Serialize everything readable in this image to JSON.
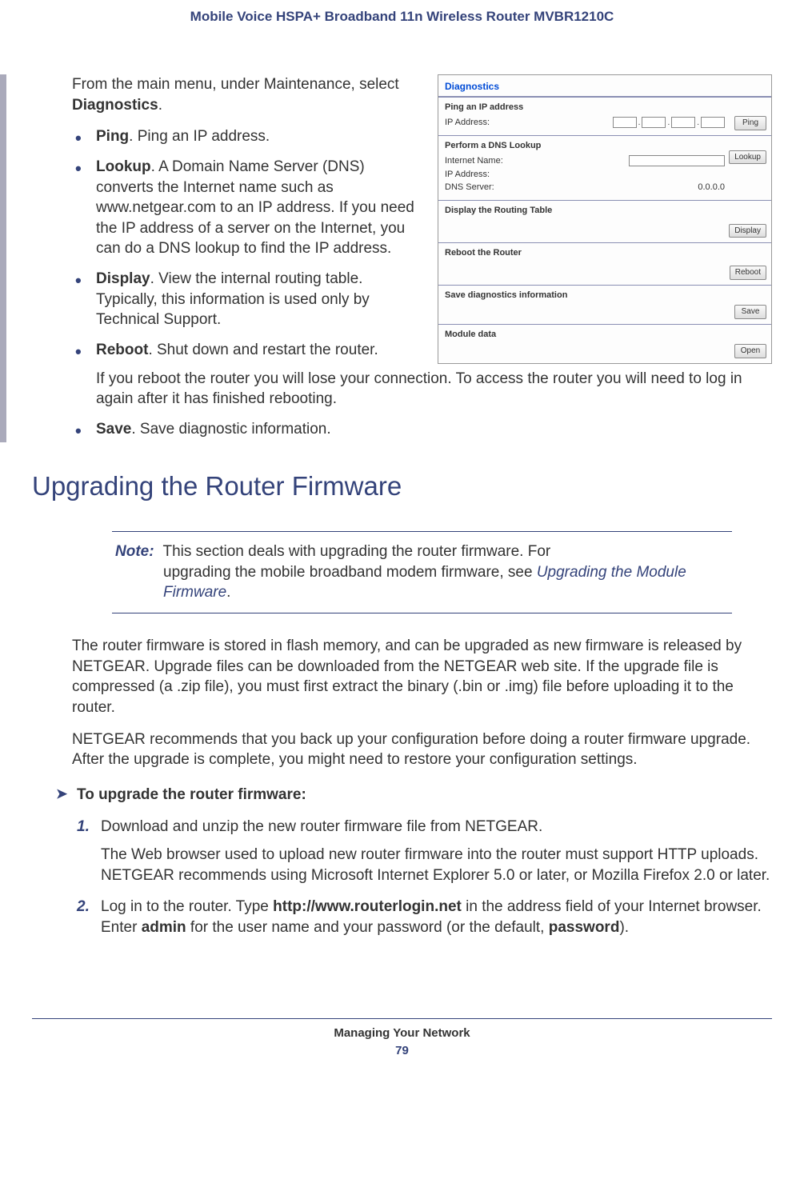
{
  "header": "Mobile Voice HSPA+ Broadband 11n Wireless Router MVBR1210C",
  "intro": {
    "pre": "From the main menu, under Maintenance, select ",
    "bold": "Diagnostics",
    "post": "."
  },
  "features": [
    {
      "term": "Ping",
      "desc": ". Ping an IP address.",
      "wrap": true
    },
    {
      "term": "Lookup",
      "desc": ". A Domain Name Server (DNS) converts the Internet name such as www.netgear.com to an IP address. If you need the IP address of a server on the Internet, you can do a DNS lookup to find the IP address.",
      "wrap": true
    },
    {
      "term": "Display",
      "desc": ". View the internal routing table. Typically, this information is used only by Technical Support.",
      "wrap": true
    },
    {
      "term": "Reboot",
      "desc": ". Shut down and restart the router.",
      "wrap": true,
      "sub": "If you reboot the router you will lose your connection. To access the router you will need to log in again after it has finished rebooting."
    },
    {
      "term": "Save",
      "desc": ". Save diagnostic information."
    }
  ],
  "shot": {
    "title": "Diagnostics",
    "ping": {
      "title": "Ping an IP address",
      "label": "IP Address:",
      "btn": "Ping"
    },
    "lookup": {
      "title": "Perform a DNS Lookup",
      "name_label": "Internet Name:",
      "ip_label": "IP Address:",
      "dns_label": "DNS Server:",
      "dns_val": "0.0.0.0",
      "btn": "Lookup"
    },
    "display": {
      "title": "Display the Routing Table",
      "btn": "Display"
    },
    "reboot": {
      "title": "Reboot the Router",
      "btn": "Reboot"
    },
    "save": {
      "title": "Save diagnostics information",
      "btn": "Save"
    },
    "module": {
      "title": "Module data",
      "btn": "Open"
    }
  },
  "section_heading": "Upgrading the Router Firmware",
  "note": {
    "label": "Note:",
    "text1": "This section deals with upgrading the router firmware. For",
    "text2": "upgrading the mobile broadband modem firmware, see ",
    "link": "Upgrading the Module Firmware",
    "post": "."
  },
  "body1": "The router firmware is stored in flash memory, and can be upgraded as new firmware is released by NETGEAR. Upgrade files can be downloaded from the NETGEAR web site. If the upgrade file is compressed (a .zip file), you must first extract the binary (.bin or .img) file before uploading it to the router.",
  "body2": "NETGEAR recommends that you back up your configuration before doing a router firmware upgrade. After the upgrade is complete, you might need to restore your configuration settings.",
  "proc_head": "To upgrade the router firmware:",
  "steps": [
    {
      "main": "Download and unzip the new router firmware file from NETGEAR.",
      "sub": "The Web browser used to upload new router firmware into the router must support HTTP uploads. NETGEAR recommends using Microsoft Internet Explorer 5.0 or later, or Mozilla Firefox 2.0 or later."
    },
    {
      "main_pre": "Log in to the router. Type ",
      "b1": "http://www.routerlogin.net",
      "main_mid": " in the address field of your Internet browser. Enter ",
      "b2": "admin",
      "main_mid2": " for the user name and your password (or the default, ",
      "b3": "password",
      "main_post": ")."
    }
  ],
  "footer": {
    "chapter": "Managing Your Network",
    "page": "79"
  }
}
